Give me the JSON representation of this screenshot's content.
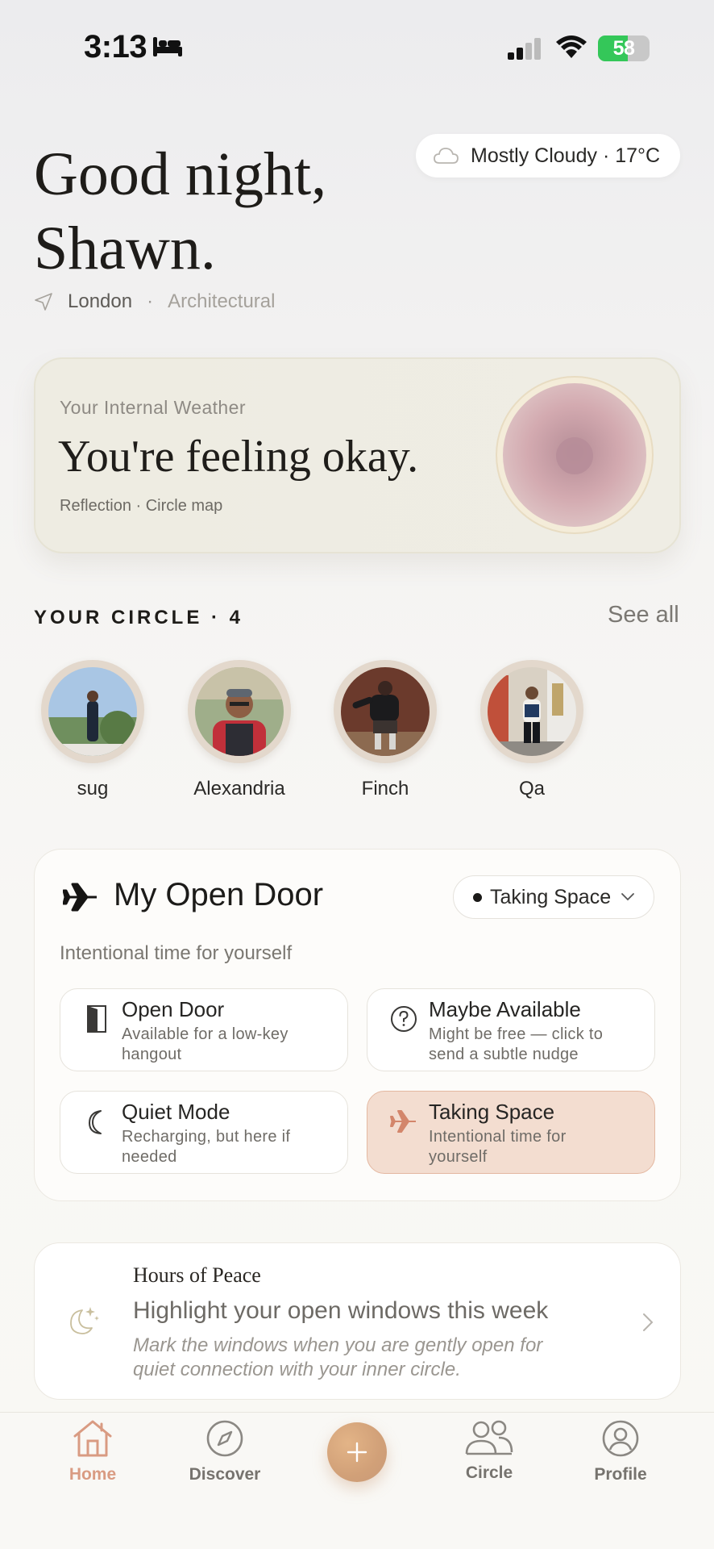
{
  "status_bar": {
    "time": "3:13",
    "sleep_icon": "bed-icon",
    "battery": 58
  },
  "greeting": {
    "line1": "Good night,",
    "line2": "Shawn."
  },
  "weather": {
    "icon": "cloud-icon",
    "text": "Mostly Cloudy · 17°C"
  },
  "location": {
    "icon": "location-arrow-icon",
    "city": "London",
    "separator": "·",
    "style": "Architectural"
  },
  "internal_weather": {
    "label": "Your Internal Weather",
    "title": "You're feeling okay.",
    "links": "Reflection · Circle map"
  },
  "circle": {
    "header": "YOUR CIRCLE · 4",
    "see_all": "See all",
    "members": [
      {
        "name": "sug"
      },
      {
        "name": "Alexandria"
      },
      {
        "name": "Finch"
      },
      {
        "name": "Qa"
      }
    ]
  },
  "open_door": {
    "icon": "airplane-icon",
    "title": "My Open Door",
    "status": "Taking Space",
    "subtitle": "Intentional time for yourself",
    "options": [
      {
        "icon": "door-icon",
        "title": "Open Door",
        "desc": "Available for a low-key hangout",
        "active": false
      },
      {
        "icon": "question-icon",
        "title": "Maybe Available",
        "desc": "Might be free — click to send a subtle nudge",
        "active": false
      },
      {
        "icon": "moon-icon",
        "title": "Quiet Mode",
        "desc": "Recharging, but here if needed",
        "active": false
      },
      {
        "icon": "airplane-icon",
        "title": "Taking Space",
        "desc": "Intentional time for yourself",
        "active": true
      }
    ]
  },
  "hours_of_peace": {
    "icon": "moon-stars-icon",
    "label": "Hours of Peace",
    "title": "Highlight your open windows this week",
    "desc": "Mark the windows when you are gently open for quiet connection with your inner circle."
  },
  "tabs": [
    {
      "label": "Home",
      "icon": "home-icon",
      "active": true
    },
    {
      "label": "Discover",
      "icon": "compass-icon",
      "active": false
    },
    {
      "label": "Circle",
      "icon": "people-icon",
      "active": false
    },
    {
      "label": "Profile",
      "icon": "profile-icon",
      "active": false
    }
  ],
  "colors": {
    "accent": "#d99b82",
    "active_option_bg": "#f3ddd0",
    "fab": "#d1a078"
  }
}
